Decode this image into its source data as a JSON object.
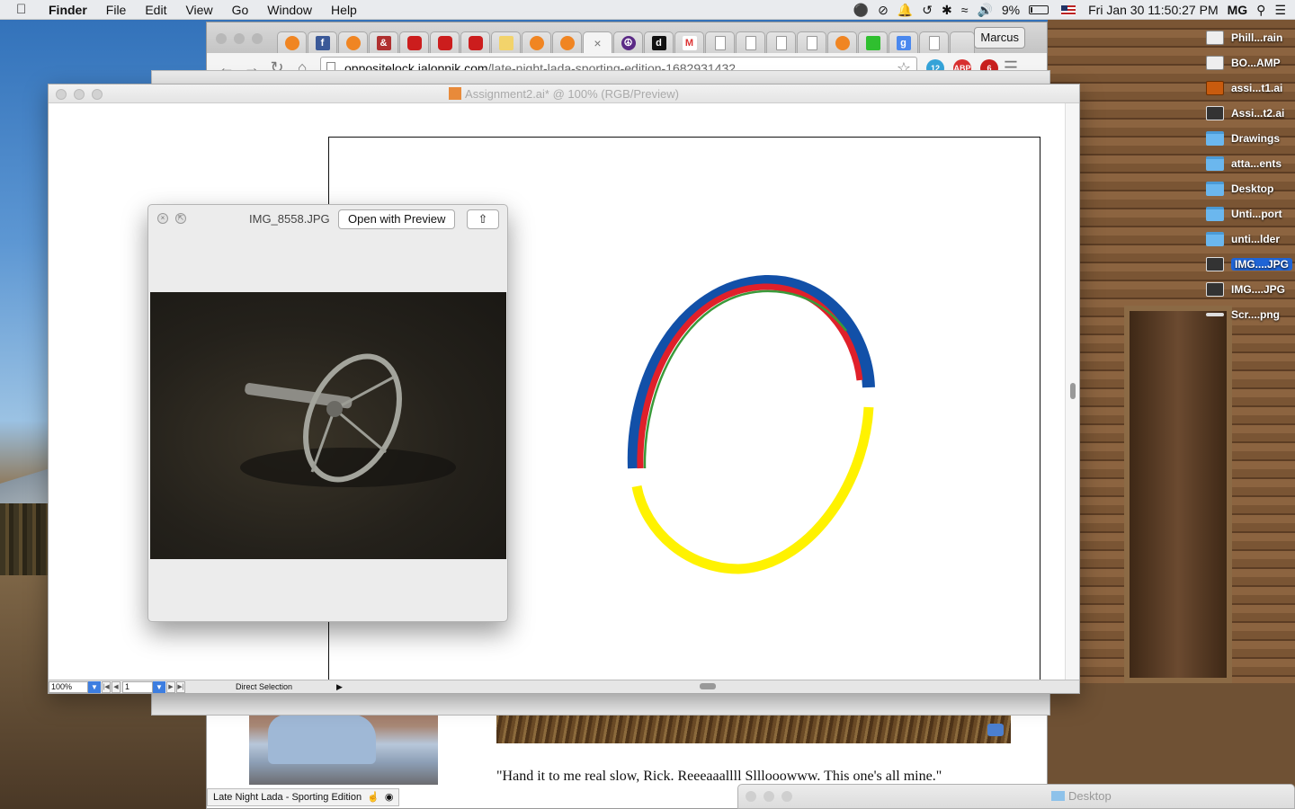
{
  "menubar": {
    "app_name": "Finder",
    "menus": [
      "File",
      "Edit",
      "View",
      "Go",
      "Window",
      "Help"
    ],
    "battery": "9%",
    "clock": "Fri Jan 30  11:50:27 PM",
    "user": "MG"
  },
  "desktop_icons": [
    {
      "label": "Phill...rain",
      "icon": "document-icon",
      "kind": "doc"
    },
    {
      "label": "BO...AMP",
      "icon": "document-icon",
      "kind": "doc"
    },
    {
      "label": "assi...t1.ai",
      "icon": "illustrator-file-icon",
      "kind": "ai"
    },
    {
      "label": "Assi...t2.ai",
      "icon": "image-file-icon",
      "kind": "img"
    },
    {
      "label": "Drawings",
      "icon": "folder-icon",
      "kind": "folder"
    },
    {
      "label": "atta...ents",
      "icon": "folder-icon",
      "kind": "folder"
    },
    {
      "label": "Desktop",
      "icon": "folder-icon",
      "kind": "folder"
    },
    {
      "label": "Unti...port",
      "icon": "folder-icon",
      "kind": "folder"
    },
    {
      "label": "unti...lder",
      "icon": "folder-icon",
      "kind": "folder"
    },
    {
      "label": "IMG....JPG",
      "icon": "image-file-icon",
      "kind": "img",
      "selected": true
    },
    {
      "label": "IMG....JPG",
      "icon": "image-file-icon",
      "kind": "img"
    },
    {
      "label": "Scr....png",
      "icon": "screenshot-file-icon",
      "kind": "dash"
    }
  ],
  "browser": {
    "profile": "Marcus",
    "tabs": [
      {
        "icon": "orange-circle",
        "cls": "orange"
      },
      {
        "icon": "facebook",
        "cls": "fb",
        "glyph": "f"
      },
      {
        "icon": "orange-circle",
        "cls": "orange"
      },
      {
        "icon": "news",
        "cls": "news",
        "glyph": "&"
      },
      {
        "icon": "youtube",
        "cls": "yt"
      },
      {
        "icon": "youtube",
        "cls": "yt"
      },
      {
        "icon": "youtube",
        "cls": "yt"
      },
      {
        "icon": "mail",
        "cls": "mail"
      },
      {
        "icon": "orange-circle",
        "cls": "orange"
      },
      {
        "icon": "orange-circle",
        "cls": "orange"
      },
      {
        "icon": "close",
        "cls": "close",
        "active": true
      },
      {
        "icon": "peace",
        "cls": "peace",
        "glyph": "☮"
      },
      {
        "icon": "d",
        "cls": "d",
        "glyph": "d"
      },
      {
        "icon": "gmail",
        "cls": "gm",
        "glyph": "M"
      },
      {
        "icon": "page",
        "cls": "page"
      },
      {
        "icon": "page",
        "cls": "page"
      },
      {
        "icon": "page",
        "cls": "page"
      },
      {
        "icon": "page",
        "cls": "page"
      },
      {
        "icon": "orange-circle",
        "cls": "orange"
      },
      {
        "icon": "green",
        "cls": "green"
      },
      {
        "icon": "google",
        "cls": "google",
        "glyph": "g"
      },
      {
        "icon": "page",
        "cls": "page"
      }
    ],
    "url_domain": "oppositelock.jalopnik.com",
    "url_path": "/late-night-lada-sporting-edition-1682931432",
    "ext_badges": [
      "12",
      "ABP",
      "6"
    ],
    "status_tooltip": "Late Night Lada - Sporting Edition",
    "page_quote": "\"Hand it to me real slow, Rick. Reeeaaallll Slllooowww. This one's all mine.\""
  },
  "illustrator": {
    "title": "Assignment2.ai* @ 100% (RGB/Preview)",
    "zoom": "100%",
    "artboard_number": "1",
    "tool": "Direct Selection",
    "ring_colors": {
      "blue": "#1250a8",
      "red": "#e0202a",
      "green": "#3a9a3a",
      "yellow": "#fff200"
    }
  },
  "quicklook": {
    "filename": "IMG_8558.JPG",
    "open_button": "Open with Preview"
  },
  "finder_window": {
    "title": "Desktop"
  }
}
